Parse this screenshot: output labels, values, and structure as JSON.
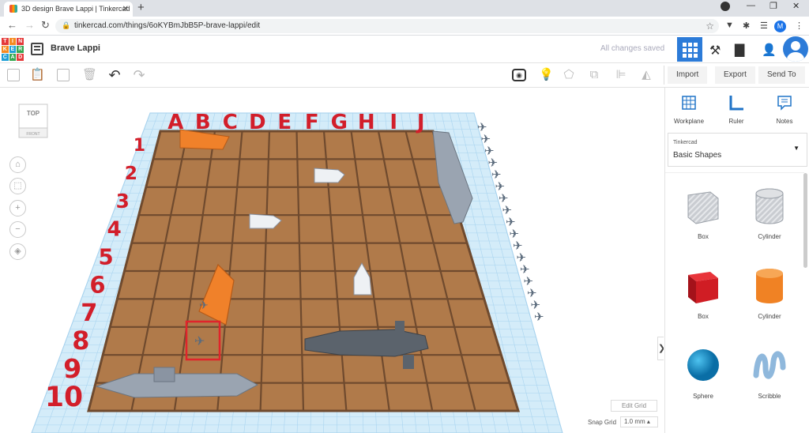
{
  "browser": {
    "tab_title": "3D design Brave Lappi | Tinkercad",
    "tab_close": "✕",
    "new_tab": "+",
    "url": "tinkercad.com/things/6oKYBmJbB5P-brave-lappi/edit",
    "profile_initial": "M"
  },
  "app": {
    "logo_letters": [
      "T",
      "I",
      "N",
      "K",
      "E",
      "R",
      "C",
      "A",
      "D"
    ],
    "design_title": "Brave Lappi",
    "save_status": "All changes saved"
  },
  "toolbar": {
    "import_label": "Import",
    "export_label": "Export",
    "send_to_label": "Send To"
  },
  "viewcube": {
    "top_label": "TOP",
    "front_label": "FRONT"
  },
  "workplane": {
    "edit_grid_label": "Edit Grid",
    "snap_grid_label": "Snap Grid",
    "snap_grid_value": "1.0 mm ▴",
    "column_letters": [
      "A",
      "B",
      "C",
      "D",
      "E",
      "F",
      "G",
      "H",
      "I",
      "J"
    ],
    "row_numbers": [
      "1",
      "2",
      "3",
      "4",
      "5",
      "6",
      "7",
      "8",
      "9",
      "10"
    ],
    "colors": {
      "board": "#b07a4a",
      "board_lines": "#6f4a2e",
      "letters": "#d21e2a",
      "orange_ship": "#f0812a",
      "grey_ship": "#9aa4b1",
      "submarine": "#5b636c",
      "grid_bg": "#cfe8f7",
      "selection": "#e0242b"
    }
  },
  "panel": {
    "workplane_label": "Workplane",
    "ruler_label": "Ruler",
    "notes_label": "Notes",
    "library_brand": "Tinkercad",
    "library_name": "Basic Shapes",
    "shapes": [
      {
        "name": "Box",
        "style": "striped-grey"
      },
      {
        "name": "Cylinder",
        "style": "striped-grey"
      },
      {
        "name": "Box",
        "style": "red"
      },
      {
        "name": "Cylinder",
        "style": "orange"
      },
      {
        "name": "Sphere",
        "style": "blue"
      },
      {
        "name": "Scribble",
        "style": "light-blue"
      }
    ]
  }
}
